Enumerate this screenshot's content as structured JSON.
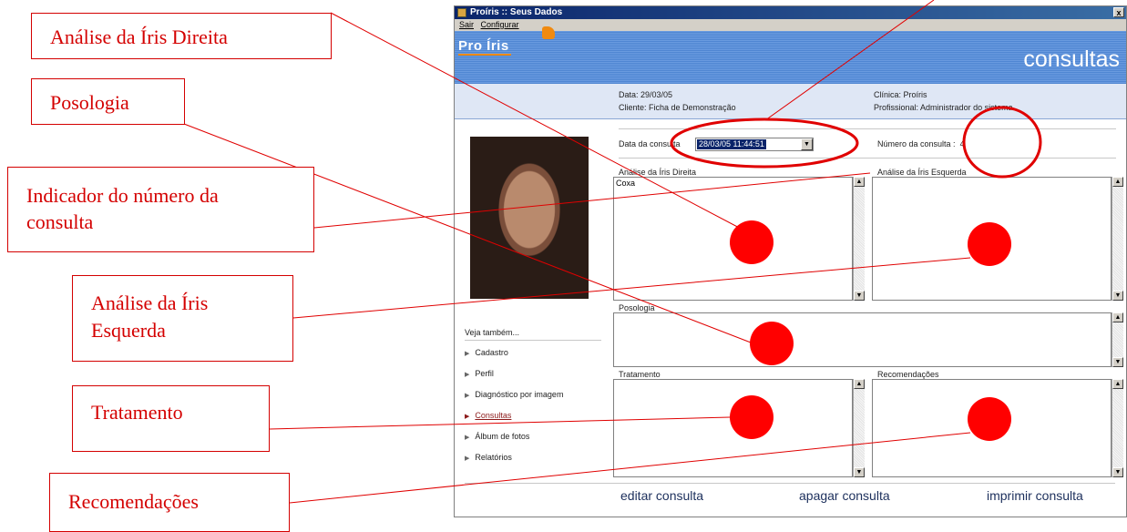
{
  "window": {
    "title": "Proíris :: Seus Dados",
    "close_glyph": "x",
    "menu": [
      "Sair",
      "Configurar"
    ]
  },
  "banner": {
    "logo_text": "Pro Íris",
    "heading": "consultas"
  },
  "info": {
    "data_label": "Data:",
    "data_value": "29/03/05",
    "cliente_label": "Cliente:",
    "cliente_value": "Ficha de Demonstração",
    "clinica_label": "Clínica:",
    "clinica_value": "Proíris",
    "profissional_label": "Profissional:",
    "profissional_value": "Administrador do sistema"
  },
  "consulta": {
    "data_label": "Data da consulta",
    "data_value": "28/03/05 11:44:51",
    "numero_label": "Número da consulta :",
    "numero_value": "4"
  },
  "fields": {
    "iris_direita_label": "Análise da Íris Direita",
    "iris_direita_value": "Coxa",
    "iris_esquerda_label": "Análise da Íris Esquerda",
    "iris_esquerda_value": "",
    "posologia_label": "Posologia",
    "posologia_value": "",
    "tratamento_label": "Tratamento",
    "tratamento_value": "",
    "recomendacoes_label": "Recomendações",
    "recomendacoes_value": ""
  },
  "sidebar": {
    "heading": "Veja também...",
    "items": [
      {
        "label": "Cadastro",
        "active": false
      },
      {
        "label": "Perfil",
        "active": false
      },
      {
        "label": "Diagnóstico por imagem",
        "active": false
      },
      {
        "label": "Consultas",
        "active": true
      },
      {
        "label": "Álbum de fotos",
        "active": false
      },
      {
        "label": "Relatórios",
        "active": false
      }
    ]
  },
  "actions": {
    "editar": "editar consulta",
    "apagar": "apagar consulta",
    "imprimir": "imprimir consulta"
  },
  "callouts": {
    "iris_direita": "Análise da Íris Direita",
    "posologia": "Posologia",
    "numero_line1": "Indicador do número da",
    "numero_line2": "consulta",
    "iris_esquerda_line1": "Análise da Íris",
    "iris_esquerda_line2": "Esquerda",
    "tratamento": "Tratamento",
    "recomendacoes": "Recomendações"
  },
  "colors": {
    "callout_red": "#d40000",
    "banner_blue": "#5b8fd6",
    "title_blue": "#0a246a",
    "active_link": "#8b1a1a"
  }
}
